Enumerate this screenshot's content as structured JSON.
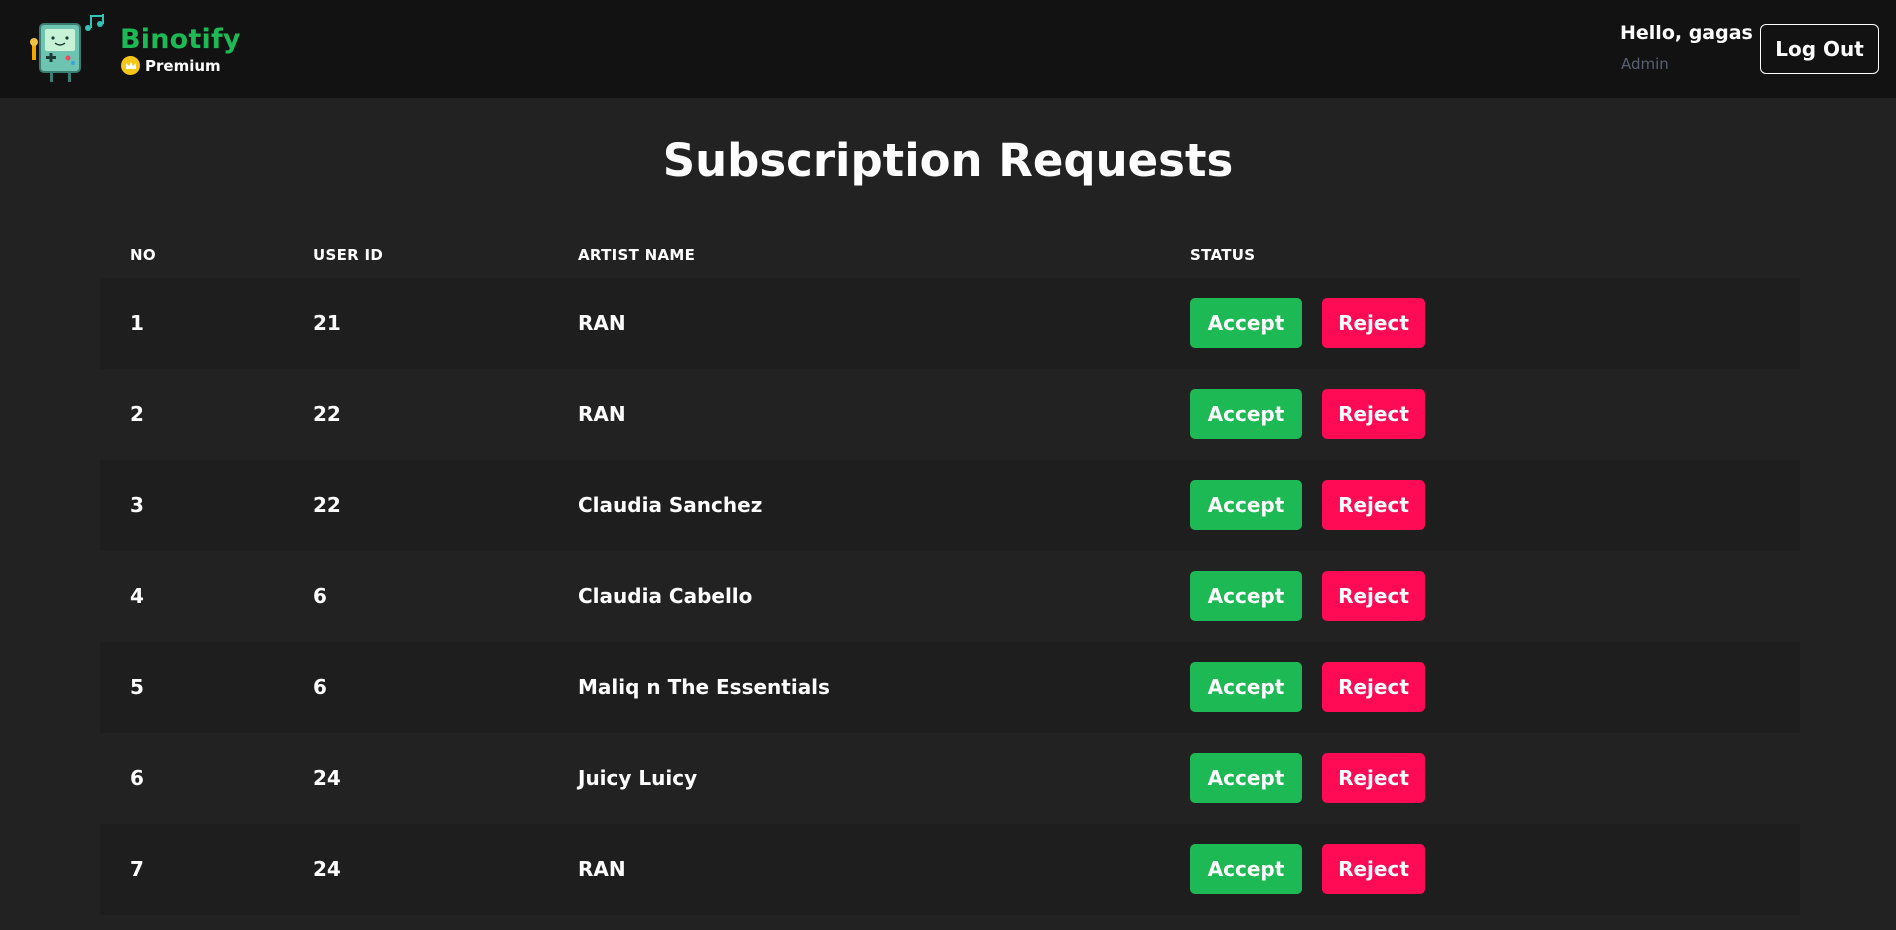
{
  "header": {
    "brand": "Binotify",
    "plan": "Premium",
    "greeting": "Hello, gagas",
    "role": "Admin",
    "logout_label": "Log Out",
    "colors": {
      "brand": "#1db954",
      "background": "#121212"
    }
  },
  "page": {
    "title": "Subscription Requests"
  },
  "table": {
    "headers": {
      "no": "NO",
      "user_id": "USER ID",
      "artist_name": "ARTIST NAME",
      "status": "STATUS"
    },
    "accept_label": "Accept",
    "reject_label": "Reject",
    "rows": [
      {
        "no": "1",
        "user_id": "21",
        "artist": "RAN"
      },
      {
        "no": "2",
        "user_id": "22",
        "artist": "RAN"
      },
      {
        "no": "3",
        "user_id": "22",
        "artist": "Claudia Sanchez"
      },
      {
        "no": "4",
        "user_id": "6",
        "artist": "Claudia Cabello"
      },
      {
        "no": "5",
        "user_id": "6",
        "artist": "Maliq n The Essentials"
      },
      {
        "no": "6",
        "user_id": "24",
        "artist": "Juicy Luicy"
      },
      {
        "no": "7",
        "user_id": "24",
        "artist": "RAN"
      }
    ],
    "colors": {
      "accept": "#1db954",
      "reject": "#ff0a54"
    }
  }
}
